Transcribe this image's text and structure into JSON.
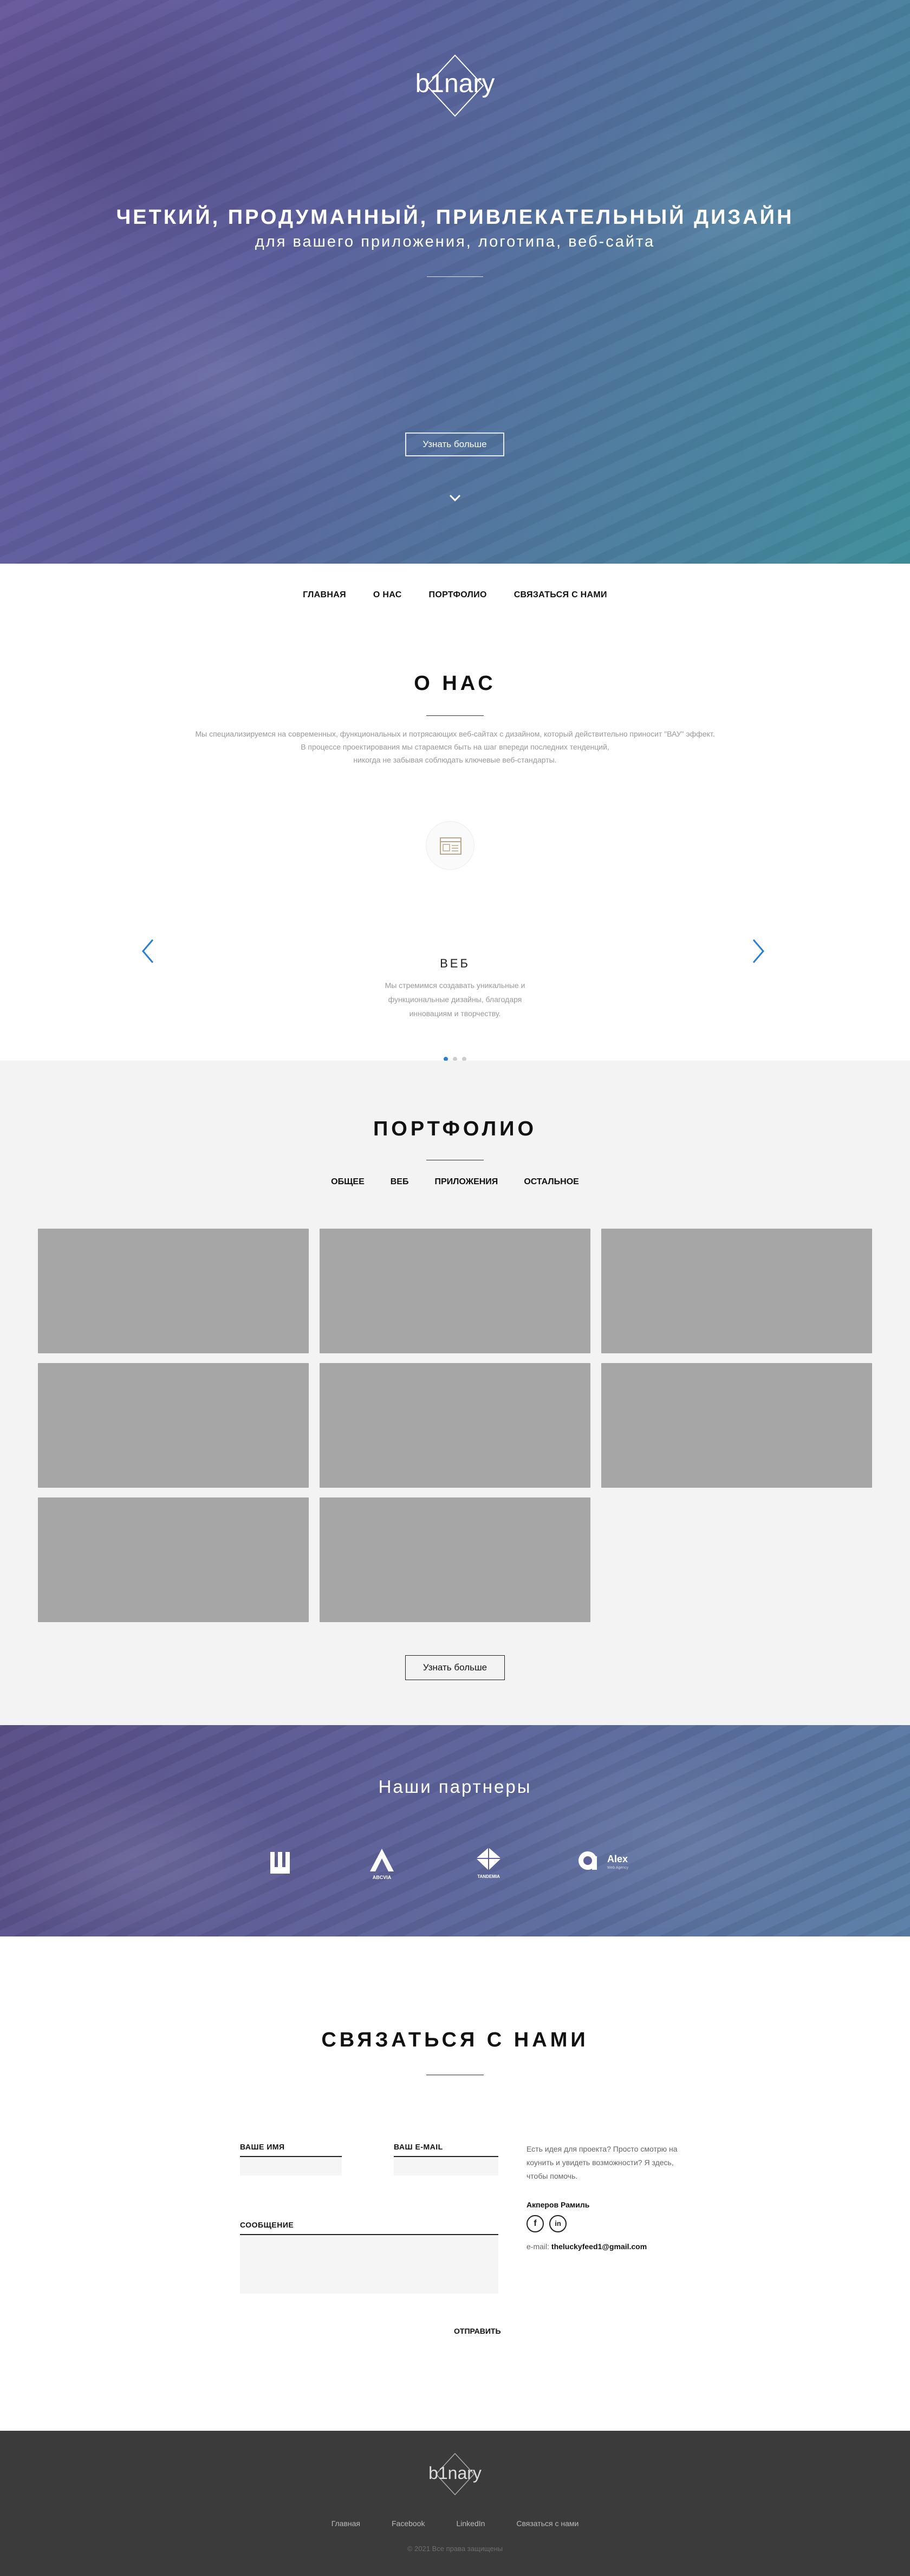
{
  "hero": {
    "logo_text": "b1nary",
    "headline": "ЧЕТКИЙ, ПРОДУМАННЫЙ, ПРИВЛЕКАТЕЛЬНЫЙ ДИЗАЙН",
    "subheadline": "для вашего приложения, логотипа, веб-сайта",
    "button_label": "Узнать больше",
    "scroll_icon": "chevron-down-icon"
  },
  "nav": {
    "items": [
      "ГЛАВНАЯ",
      "О НАС",
      "ПОРТФОЛИО",
      "СВЯЗАТЬСЯ С НАМИ"
    ]
  },
  "about": {
    "title": "О НАС",
    "description": [
      "Мы специализируемся на современных, функциональных и потрясающих веб-сайтах с дизайном, который действительно приносит \"ВАУ\" эффект.",
      "В процессе проектирования мы стараемся быть на шаг впереди последних тенденций,",
      "никогда не забывая соблюдать ключевые веб-стандарты."
    ],
    "slide": {
      "icon": "browser-window-icon",
      "title": "ВЕБ",
      "text": "Мы стремимся создавать уникальные и функциональные дизайны, благодаря инновациям и творчеству."
    },
    "prev_icon": "chevron-left-icon",
    "next_icon": "chevron-right-icon",
    "slides_count": 3,
    "active_slide": 1,
    "accent_color": "#2a7fd4"
  },
  "portfolio": {
    "title": "ПОРТФОЛИО",
    "filters": [
      "ОБЩЕЕ",
      "ВЕБ",
      "ПРИЛОЖЕНИЯ",
      "ОСТАЛЬНОЕ"
    ],
    "item_count": 8,
    "button_label": "Узнать больше"
  },
  "partners": {
    "title": "Наши партнеры",
    "logos": [
      {
        "icon": "w-logo-icon",
        "label": ""
      },
      {
        "icon": "abcvia-logo-icon",
        "label": "ABCVIA"
      },
      {
        "icon": "tandem-logo-icon",
        "label": "TANDEMIA"
      },
      {
        "icon": "alex-logo-icon",
        "label": "Alex"
      }
    ],
    "alex_sub": "Web Agency"
  },
  "contact": {
    "title": "СВЯЗАТЬСЯ С НАМИ",
    "name_label": "ВАШЕ ИМЯ",
    "email_label": "ВАШ E-MAIL",
    "message_label": "СООБЩЕНИЕ",
    "send_label": "ОТПРАВИТЬ",
    "info_text": "Есть идея для проекта? Просто смотрю на коунить и увидеть возможности? Я здесь, чтобы помочь.",
    "person_name": "Акперов Рамиль",
    "email_prefix": "e-mail:",
    "email": "theluckyfeed1@gmail.com",
    "social": [
      {
        "icon": "facebook-icon",
        "glyph": "f"
      },
      {
        "icon": "linkedin-icon",
        "glyph": "in"
      }
    ]
  },
  "footer": {
    "logo_text": "b1nary",
    "links": [
      "Главная",
      "Facebook",
      "LinkedIn",
      "Связаться с нами"
    ],
    "copyright": "© 2021 Все права защищены"
  }
}
